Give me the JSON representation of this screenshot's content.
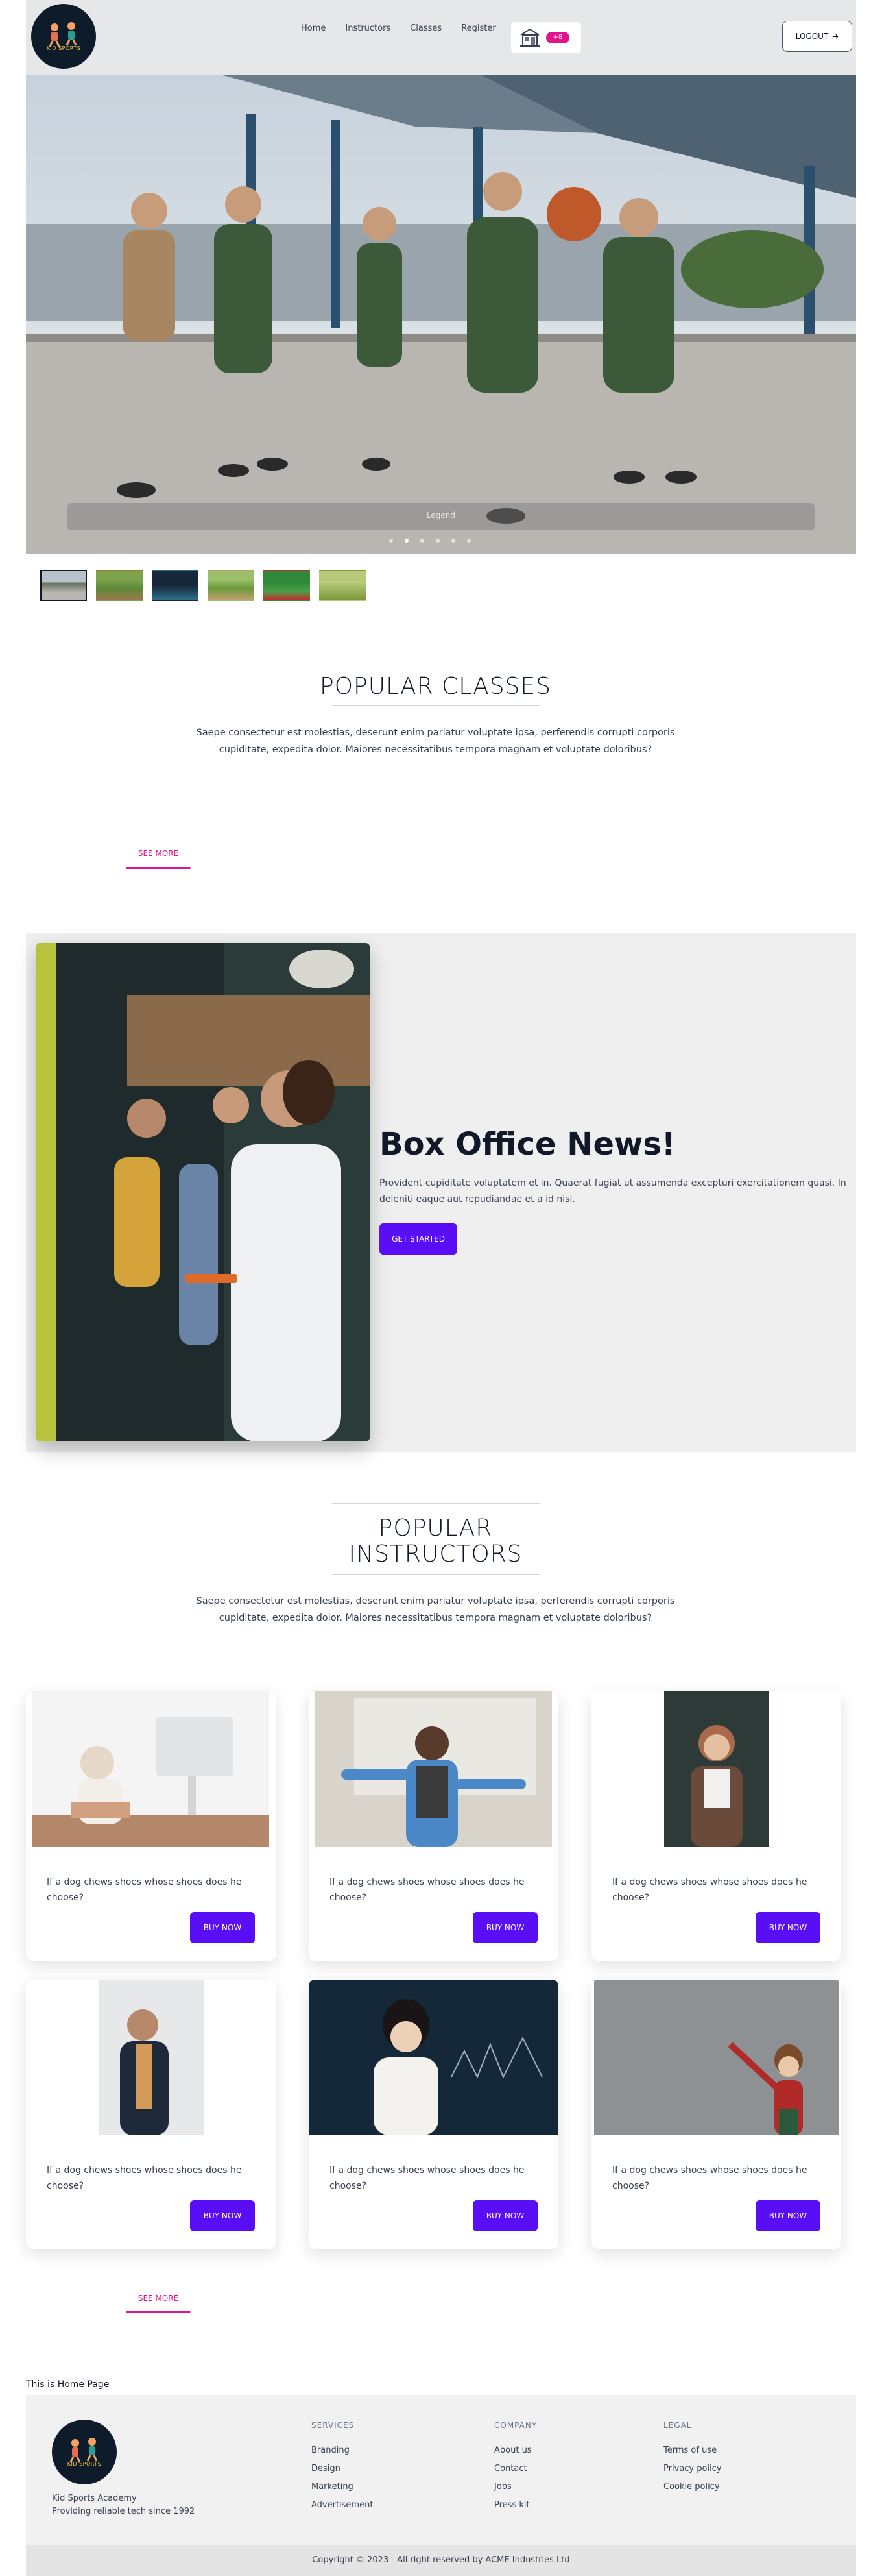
{
  "brand": {
    "logo_text": "KID SPORTS",
    "name": "Kid Sports Academy",
    "tagline": "Providing reliable tech since 1992"
  },
  "nav": {
    "links": [
      "Home",
      "Instructors",
      "Classes",
      "Register"
    ],
    "cart_count": "+8",
    "logout_label": "LOGOUT"
  },
  "hero": {
    "caption": "Legend",
    "slide_count": 6,
    "active_slide": 1,
    "thumb_count": 6
  },
  "popular_classes": {
    "title": "POPULAR CLASSES",
    "description": "Saepe consectetur est molestias, deserunt enim pariatur voluptate ipsa, perferendis corrupti corporis cupiditate, expedita dolor. Maiores necessitatibus tempora magnam et voluptate doloribus?",
    "see_more": "SEE MORE"
  },
  "box_office": {
    "title": "Box Office News!",
    "text": "Provident cupiditate voluptatem et in. Quaerat fugiat ut assumenda excepturi exercitationem quasi. In deleniti eaque aut repudiandae et a id nisi.",
    "button": "GET STARTED"
  },
  "popular_instructors": {
    "title_line1": "POPULAR",
    "title_line2": "INSTRUCTORS",
    "description": "Saepe consectetur est molestias, deserunt enim pariatur voluptate ipsa, perferendis corrupti corporis cupiditate, expedita dolor. Maiores necessitatibus tempora magnam et voluptate doloribus?",
    "see_more": "SEE MORE",
    "cards": [
      {
        "text": "If a dog chews shoes whose shoes does he choose?",
        "button": "BUY NOW"
      },
      {
        "text": "If a dog chews shoes whose shoes does he choose?",
        "button": "BUY NOW"
      },
      {
        "text": "If a dog chews shoes whose shoes does he choose?",
        "button": "BUY NOW"
      },
      {
        "text": "If a dog chews shoes whose shoes does he choose?",
        "button": "BUY NOW"
      },
      {
        "text": "If a dog chews shoes whose shoes does he choose?",
        "button": "BUY NOW"
      },
      {
        "text": "If a dog chews shoes whose shoes does he choose?",
        "button": "BUY NOW"
      }
    ]
  },
  "page_label": "This is Home Page",
  "footer": {
    "services": {
      "title": "SERVICES",
      "links": [
        "Branding",
        "Design",
        "Marketing",
        "Advertisement"
      ]
    },
    "company": {
      "title": "COMPANY",
      "links": [
        "About us",
        "Contact",
        "Jobs",
        "Press kit"
      ]
    },
    "legal": {
      "title": "LEGAL",
      "links": [
        "Terms of use",
        "Privacy policy",
        "Cookie policy"
      ]
    },
    "copyright": "Copyright © 2023 - All right reserved by ACME Industries Ltd"
  },
  "colors": {
    "accent": "#5a0ef6",
    "pink": "#e1148c",
    "dark": "#111827"
  }
}
